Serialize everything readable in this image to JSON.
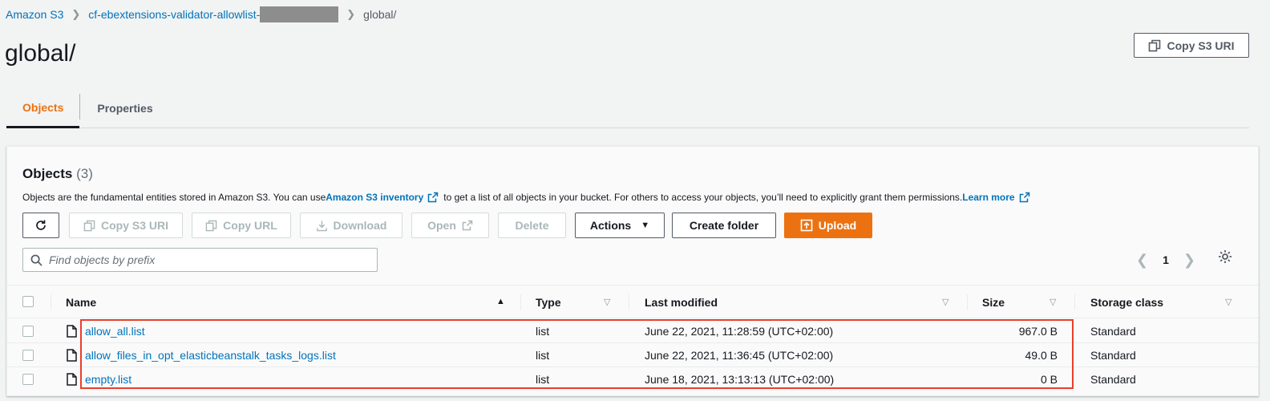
{
  "breadcrumb": {
    "root": "Amazon S3",
    "bucket": "cf-ebextensions-validator-allowlist-",
    "current": "global/"
  },
  "page": {
    "title": "global/",
    "copy_uri_label": "Copy S3 URI"
  },
  "tabs": [
    {
      "label": "Objects",
      "active": true
    },
    {
      "label": "Properties",
      "active": false
    }
  ],
  "objects_panel": {
    "title": "Objects",
    "count": "(3)",
    "desc_1": "Objects are the fundamental entities stored in Amazon S3. You can use ",
    "desc_link": "Amazon S3 inventory",
    "desc_2": " to get a list of all objects in your bucket. For others to access your objects, you’ll need to explicitly grant them permissions. ",
    "learn_more": "Learn more"
  },
  "toolbar": {
    "copy_s3_uri": "Copy S3 URI",
    "copy_url": "Copy URL",
    "download": "Download",
    "open": "Open",
    "delete": "Delete",
    "actions": "Actions",
    "create_folder": "Create folder",
    "upload": "Upload"
  },
  "search": {
    "placeholder": "Find objects by prefix"
  },
  "pagination": {
    "page": "1"
  },
  "table": {
    "columns": [
      "Name",
      "Type",
      "Last modified",
      "Size",
      "Storage class"
    ],
    "rows": [
      {
        "name": "allow_all.list",
        "type": "list",
        "modified": "June 22, 2021, 11:28:59 (UTC+02:00)",
        "size": "967.0 B",
        "storage": "Standard"
      },
      {
        "name": "allow_files_in_opt_elasticbeanstalk_tasks_logs.list",
        "type": "list",
        "modified": "June 22, 2021, 11:36:45 (UTC+02:00)",
        "size": "49.0 B",
        "storage": "Standard"
      },
      {
        "name": "empty.list",
        "type": "list",
        "modified": "June 18, 2021, 13:13:13 (UTC+02:00)",
        "size": "0 B",
        "storage": "Standard"
      }
    ]
  },
  "colors": {
    "accent": "#ec7211",
    "link": "#0073bb",
    "highlight": "#e8402c"
  }
}
